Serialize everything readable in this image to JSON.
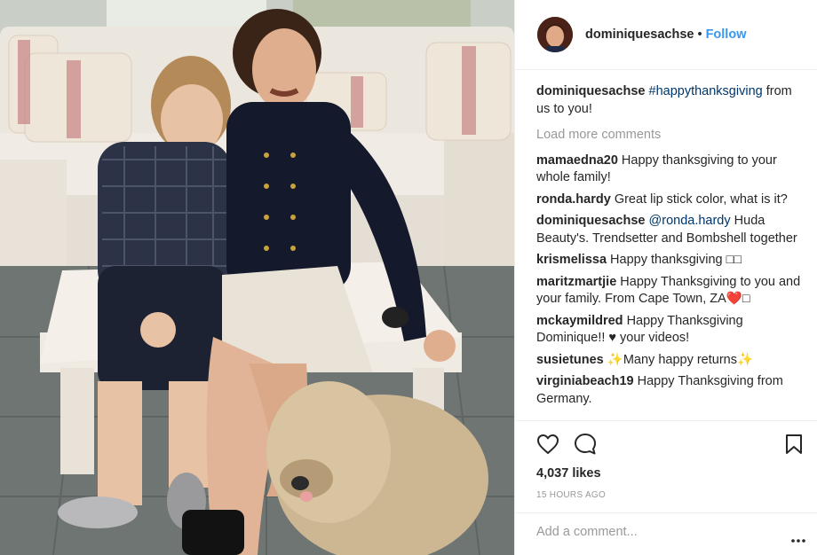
{
  "post": {
    "username": "dominiquesachse",
    "follow_label": "Follow",
    "separator": "•"
  },
  "caption": {
    "username": "dominiquesachse",
    "hashtag": "#happythanksgiving",
    "text": " from us to you!"
  },
  "load_more": "Load more comments",
  "comments": [
    {
      "user": "mamaedna20",
      "text": "Happy thanksgiving to your whole family!"
    },
    {
      "user": "ronda.hardy",
      "text": "Great lip stick color, what is it?"
    },
    {
      "user": "dominiquesachse",
      "mention": "@ronda.hardy",
      "text": " Huda Beauty's. Trendsetter and Bombshell together"
    },
    {
      "user": "krismelissa",
      "text": "Happy thanksgiving □□"
    },
    {
      "user": "maritzmartjie",
      "text": "Happy Thanksgiving to you and your family. From Cape Town, ZA❤️□"
    },
    {
      "user": "mckaymildred",
      "text": "Happy Thanksgiving Dominique!! ♥ your videos!"
    },
    {
      "user": "susietunes",
      "text": "✨Many happy returns✨"
    },
    {
      "user": "virginiabeach19",
      "text": "Happy Thanksgiving from Germany."
    }
  ],
  "likes": "4,037 likes",
  "timestamp": "15 HOURS AGO",
  "add_comment_placeholder": "Add a comment...",
  "icons": {
    "like": "heart-icon",
    "comment": "comment-bubble-icon",
    "save": "bookmark-icon",
    "more": "more-options-icon"
  }
}
